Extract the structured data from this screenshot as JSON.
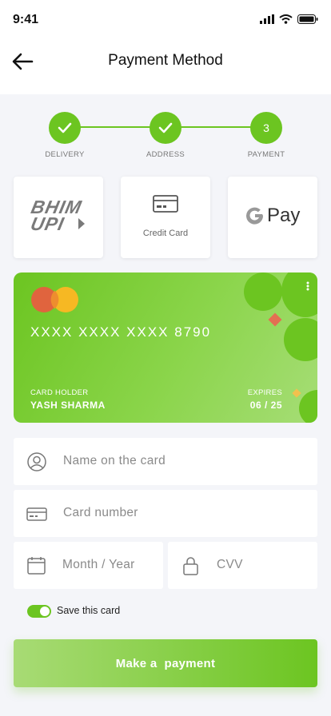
{
  "status_bar": {
    "time": "9:41"
  },
  "header": {
    "title": "Payment Method"
  },
  "stepper": {
    "steps": [
      {
        "label": "DELIVERY",
        "state": "done"
      },
      {
        "label": "ADDRESS",
        "state": "done"
      },
      {
        "label": "PAYMENT",
        "number": "3",
        "state": "current"
      }
    ]
  },
  "payment_methods": {
    "bhim": {
      "line1": "BHIM",
      "line2": "UPI"
    },
    "credit_card": {
      "label": "Credit Card"
    },
    "gpay": {
      "label": "Pay"
    }
  },
  "card": {
    "number": "XXXX XXXX XXXX 8790",
    "holder_label": "CARD HOLDER",
    "holder_name": "YASH SHARMA",
    "expires_label": "EXPIRES",
    "expires_value": "06 / 25"
  },
  "form": {
    "name_placeholder": "Name on the card",
    "number_placeholder": "Card number",
    "expiry_placeholder": "Month / Year",
    "cvv_placeholder": "CVV",
    "save_label": "Save this card",
    "save_checked": true
  },
  "actions": {
    "pay_label": "Make a  payment"
  },
  "colors": {
    "accent": "#6cc521",
    "card_gradient_end": "#a6dd76"
  }
}
